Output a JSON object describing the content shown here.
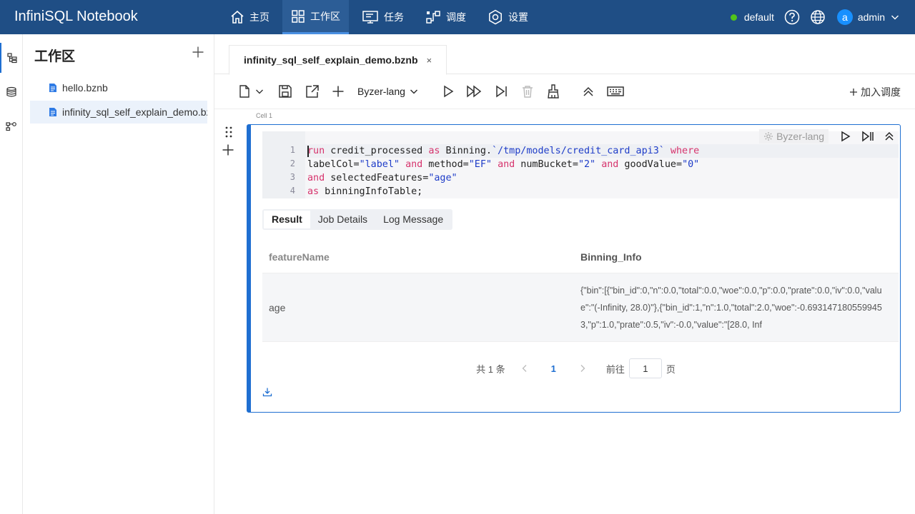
{
  "app": {
    "title": "InfiniSQL Notebook"
  },
  "nav": [
    {
      "label": "主页",
      "icon": "home-icon"
    },
    {
      "label": "工作区",
      "icon": "workspace-icon"
    },
    {
      "label": "任务",
      "icon": "monitor-icon"
    },
    {
      "label": "调度",
      "icon": "schedule-icon"
    },
    {
      "label": "设置",
      "icon": "settings-icon"
    }
  ],
  "user": {
    "env": "default",
    "avatar_letter": "a",
    "name": "admin"
  },
  "sidebar": {
    "title": "工作区",
    "files": [
      {
        "name": "hello.bznb"
      },
      {
        "name": "infinity_sql_self_explain_demo.bznb"
      }
    ]
  },
  "tab": {
    "title": "infinity_sql_self_explain_demo.bznb",
    "close": "×"
  },
  "toolbar": {
    "lang": "Byzer-lang",
    "add_schedule": "加入调度"
  },
  "cell": {
    "label": "Cell 1",
    "lang": "Byzer-lang",
    "line_numbers": [
      "1",
      "2",
      "3",
      "4"
    ]
  },
  "result_tabs": [
    "Result",
    "Job Details",
    "Log Message"
  ],
  "table": {
    "headers": [
      "featureName",
      "Binning_Info"
    ],
    "rows": [
      {
        "featureName": "age",
        "binning_info": "{\"bin\":[{\"bin_id\":0,\"n\":0.0,\"total\":0.0,\"woe\":0.0,\"p\":0.0,\"prate\":0.0,\"iv\":0.0,\"value\":\"(-Infinity, 28.0)\"},{\"bin_id\":1,\"n\":1.0,\"total\":2.0,\"woe\":-0.6931471805599453,\"p\":1.0,\"prate\":0.5,\"iv\":-0.0,\"value\":\"[28.0, Inf"
      }
    ]
  },
  "pagination": {
    "total": "共 1 条",
    "current": "1",
    "goto": "前往",
    "goto_value": "1",
    "page_suffix": "页"
  }
}
